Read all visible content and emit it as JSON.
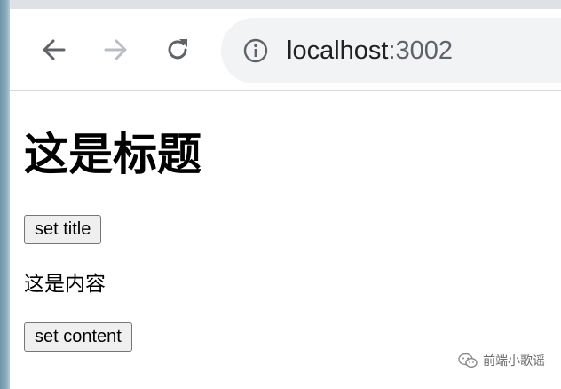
{
  "browser": {
    "back_icon": "arrow-left-icon",
    "forward_icon": "arrow-right-icon",
    "reload_icon": "reload-icon",
    "site_info_icon": "info-icon",
    "url": {
      "host": "localhost",
      "port": ":3002"
    },
    "colors": {
      "toolbar_bg": "#ffffff",
      "omnibox_bg": "#f1f3f4",
      "icon_active": "#5f6368",
      "icon_disabled": "#b9bcc0"
    }
  },
  "page": {
    "title": "这是标题",
    "set_title_label": "set title",
    "content": "这是内容",
    "set_content_label": "set content"
  },
  "watermark": {
    "icon": "wechat-icon",
    "text": "前端小歌谣"
  }
}
